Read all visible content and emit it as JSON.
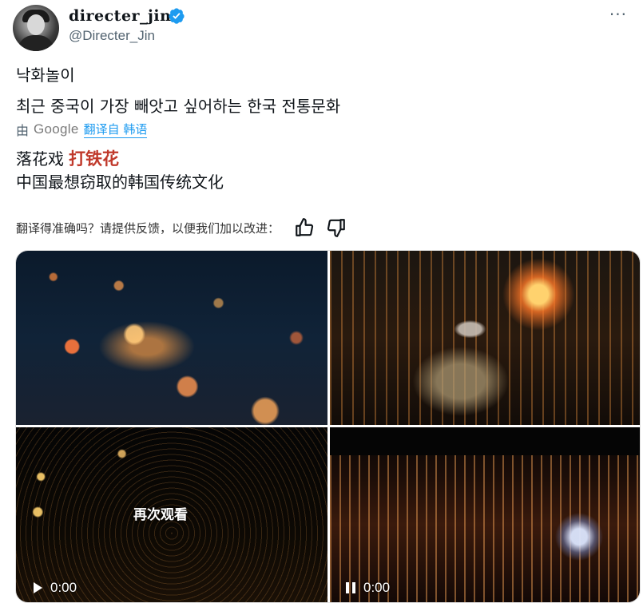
{
  "author": {
    "display_name": "directer_jin",
    "handle": "@Directer_Jin"
  },
  "tweet": {
    "line1": "낙화놀이",
    "line2": "최근 중국이 가장 빼앗고 싶어하는 한국 전통문화"
  },
  "translation": {
    "by_prefix": "由",
    "provider": "Google",
    "link_label": "翻译自 韩语",
    "line1_main": "落花戏",
    "line1_highlight": "打铁花",
    "line2": "中国最想窃取的韩国传统文化"
  },
  "feedback": {
    "question": "翻译得准确吗？请提供反馈，以便我们加以改进："
  },
  "media": {
    "replay_label": "再次观看",
    "video1_time": "0:00",
    "video2_time": "0:00"
  },
  "icons": {
    "more": "more-options-icon",
    "verified": "verified-badge-icon",
    "thumbs_up": "thumbs-up-icon",
    "thumbs_down": "thumbs-down-icon",
    "play": "play-icon",
    "pause": "pause-icon"
  },
  "colors": {
    "link": "#1d9bf0",
    "highlight": "#c0392b",
    "muted": "#536471"
  }
}
